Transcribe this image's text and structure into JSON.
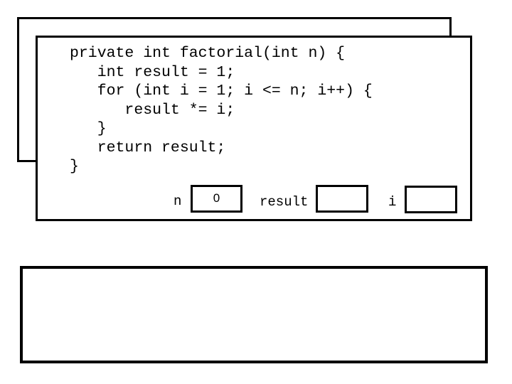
{
  "code": {
    "lines": [
      "private int factorial(int n) {",
      "   int result = 1;",
      "   for (int i = 1; i <= n; i++) {",
      "      result *= i;",
      "   }",
      "   return result;",
      "}"
    ]
  },
  "variables": [
    {
      "name": "n",
      "value": "0"
    },
    {
      "name": "result",
      "value": ""
    },
    {
      "name": "i",
      "value": ""
    }
  ],
  "console": {
    "text": ""
  }
}
